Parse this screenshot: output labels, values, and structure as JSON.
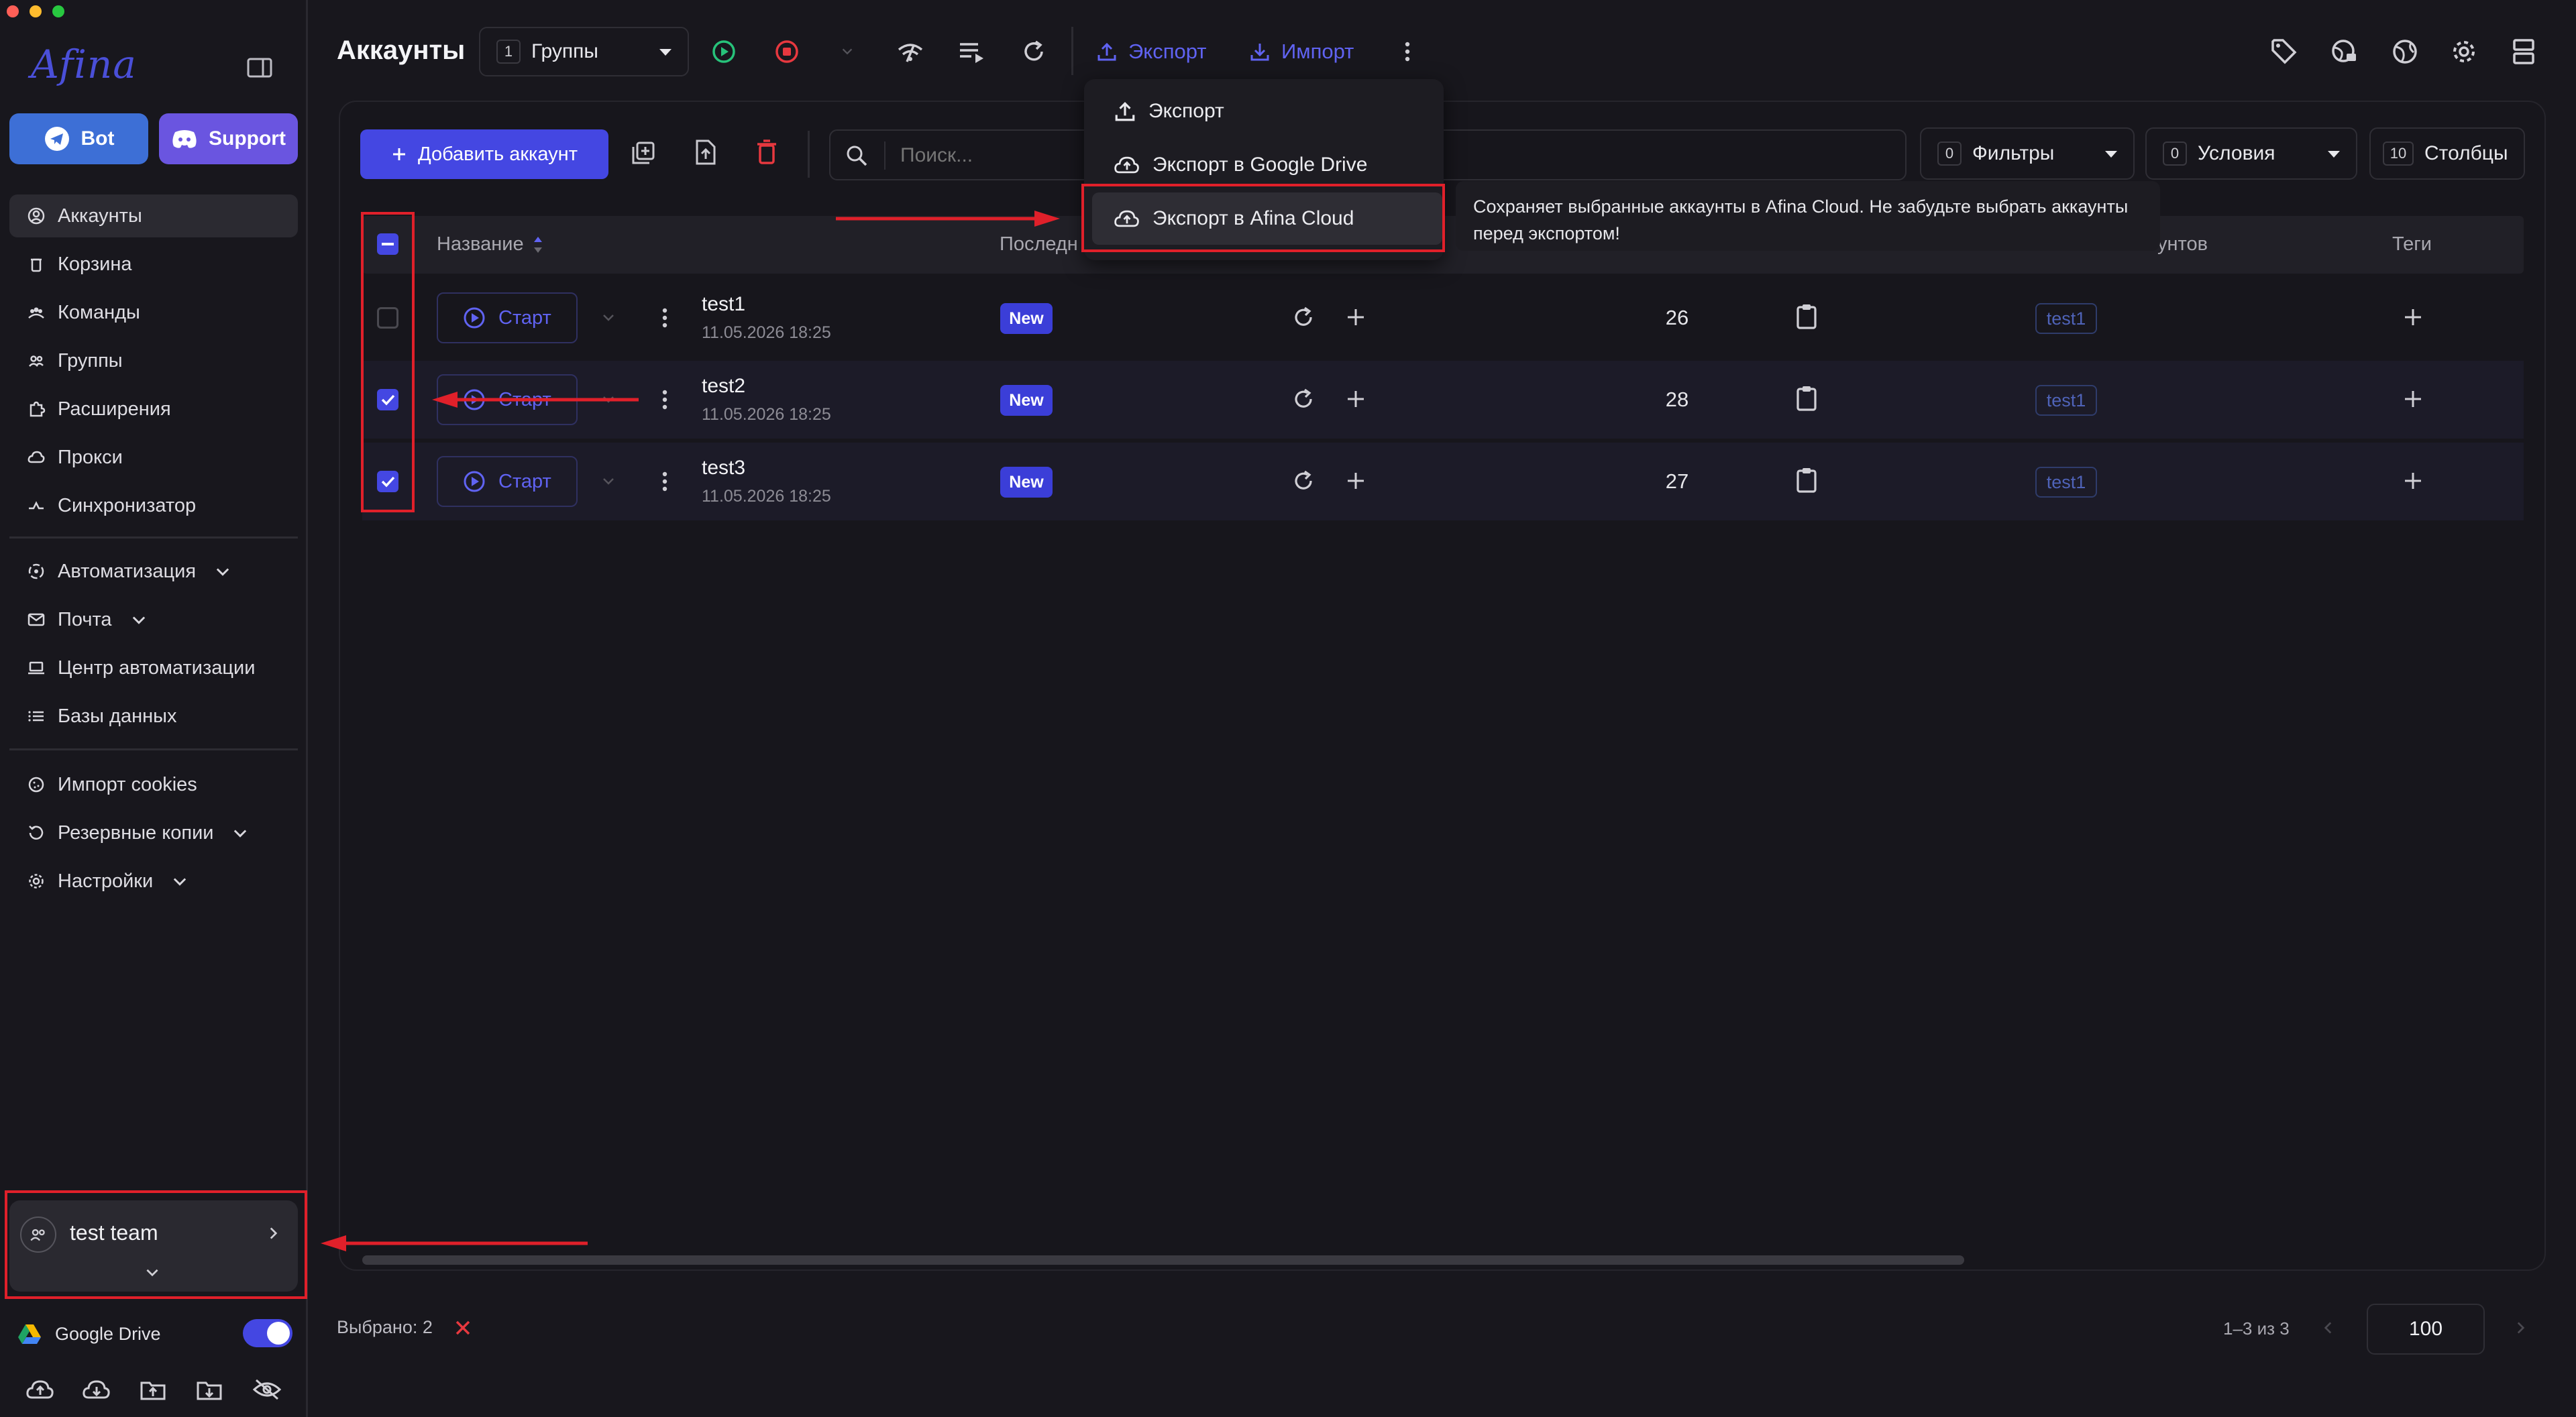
{
  "window": {
    "traffic_light_colors": [
      "#fe5f57",
      "#febc2e",
      "#28c840"
    ]
  },
  "sidebar": {
    "logo": "Afina",
    "bot_label": "Bot",
    "support_label": "Support",
    "nav": [
      {
        "label": "Аккаунты",
        "icon": "user-circle-icon"
      },
      {
        "label": "Корзина",
        "icon": "trash-icon"
      },
      {
        "label": "Команды",
        "icon": "users-icon"
      },
      {
        "label": "Группы",
        "icon": "group-icon"
      },
      {
        "label": "Расширения",
        "icon": "puzzle-icon"
      },
      {
        "label": "Прокси",
        "icon": "cloud-icon"
      },
      {
        "label": "Синхронизатор",
        "icon": "sync-icon"
      },
      {
        "label": "Автоматизация",
        "icon": "automation-icon"
      },
      {
        "label": "Почта",
        "icon": "mail-icon"
      },
      {
        "label": "Центр автоматизации",
        "icon": "laptop-icon"
      },
      {
        "label": "Базы данных",
        "icon": "list-icon"
      },
      {
        "label": "Импорт cookies",
        "icon": "cookie-icon"
      },
      {
        "label": "Резервные копии",
        "icon": "backup-icon"
      },
      {
        "label": "Настройки",
        "icon": "gear-icon"
      }
    ],
    "team_name": "test team",
    "google_drive_label": "Google Drive",
    "google_drive_enabled": true
  },
  "header": {
    "title": "Аккаунты",
    "groups_count": "1",
    "groups_label": "Группы",
    "export_label": "Экспорт",
    "import_label": "Импорт"
  },
  "toolbar": {
    "add_account_label": "Добавить аккаунт",
    "search_placeholder": "Поиск...",
    "filters_count": "0",
    "filters_label": "Фильтры",
    "conditions_count": "0",
    "conditions_label": "Условия",
    "columns_count": "10",
    "columns_label": "Столбцы"
  },
  "export_menu": {
    "items": [
      "Экспорт",
      "Экспорт в Google Drive",
      "Экспорт в Afina Cloud"
    ],
    "tooltip_line1": "Сохраняет выбранные аккаунты в Afina Cloud. Не забудьте выбрать аккаунты",
    "tooltip_line2": "перед экспортом!"
  },
  "table": {
    "headers": {
      "name": "Название",
      "last": "Последн",
      "accounts": "унтов",
      "tags": "Теги"
    },
    "start_label": "Старт",
    "status_label": "New",
    "rows": [
      {
        "name": "test1",
        "date": "11.05.2026 18:25",
        "count": "26",
        "tag": "test1",
        "checked": false
      },
      {
        "name": "test2",
        "date": "11.05.2026 18:25",
        "count": "28",
        "tag": "test1",
        "checked": true
      },
      {
        "name": "test3",
        "date": "11.05.2026 18:25",
        "count": "27",
        "tag": "test1",
        "checked": true
      }
    ]
  },
  "footer": {
    "selected_label": "Выбрано: 2",
    "pagination": "1–3 из 3",
    "page_size": "100"
  },
  "colors": {
    "accent": "#4447e2",
    "annotation_red": "#e0202a",
    "background": "#18171d"
  }
}
